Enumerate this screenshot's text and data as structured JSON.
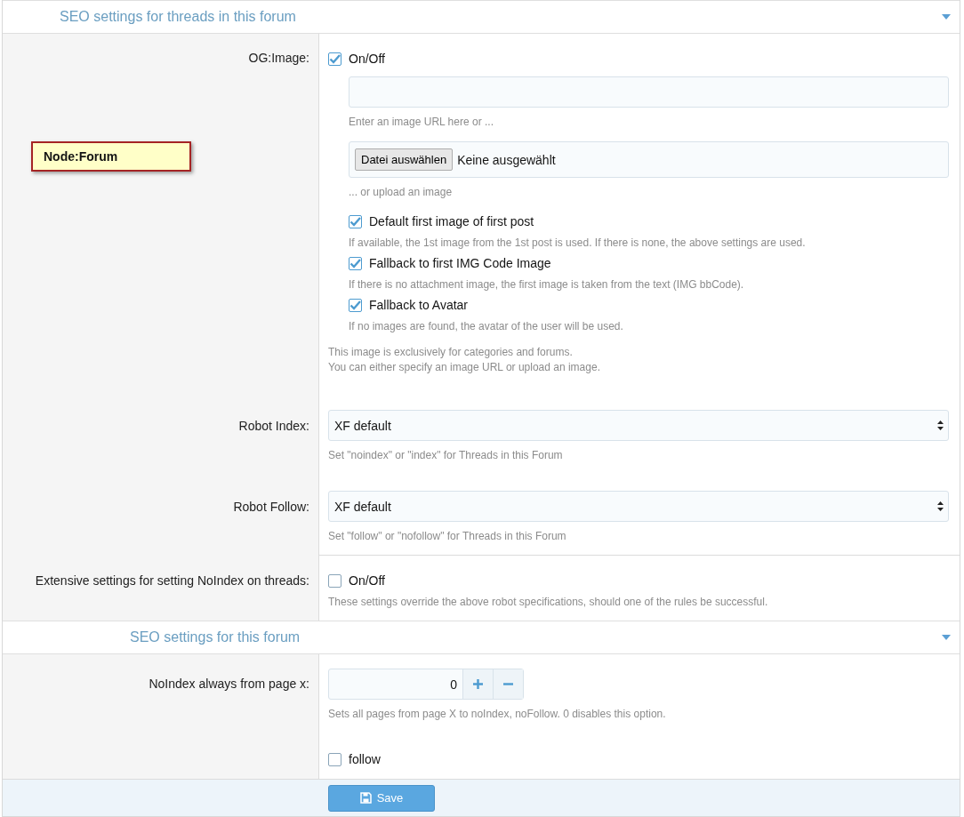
{
  "note": "Node:Forum",
  "sections": [
    {
      "title": "SEO settings for threads in this forum",
      "rows": [
        {
          "kind": "og_image",
          "label": "OG:Image:",
          "toggle": {
            "label": "On/Off",
            "checked": true
          },
          "url_hint": "Enter an image URL here or ...",
          "file_button": "Datei auswählen",
          "file_status": "Keine ausgewählt",
          "upload_hint": "... or upload an image",
          "options": [
            {
              "label": "Default first image of first post",
              "checked": true,
              "hint": "If available, the 1st image from the 1st post is used. If there is none, the above settings are used."
            },
            {
              "label": "Fallback to first IMG Code Image",
              "checked": true,
              "hint": "If there is no attachment image, the first image is taken from the text (IMG bbCode)."
            },
            {
              "label": "Fallback to Avatar",
              "checked": true,
              "hint": "If no images are found, the avatar of the user will be used."
            }
          ],
          "explain": [
            "This image is exclusively for categories and forums.",
            "You can either specify an image URL or upload an image."
          ]
        },
        {
          "kind": "select",
          "label": "Robot Index:",
          "value": "XF default",
          "hint": "Set \"noindex\" or \"index\" for Threads in this Forum"
        },
        {
          "kind": "select",
          "label": "Robot Follow:",
          "value": "XF default",
          "hint": "Set \"follow\" or \"nofollow\" for Threads in this Forum"
        },
        {
          "kind": "checkbox",
          "label": "Extensive settings for setting NoIndex on threads:",
          "option": {
            "label": "On/Off",
            "checked": false
          },
          "hint": "These settings override the above robot specifications, should one of the rules be successful."
        }
      ]
    },
    {
      "title": "SEO settings for this forum",
      "rows": [
        {
          "kind": "number",
          "label": "NoIndex always from page x:",
          "value": "0",
          "hint": "Sets all pages from page X to noIndex, noFollow. 0 disables this option.",
          "option": {
            "label": "follow",
            "checked": false
          }
        }
      ]
    }
  ],
  "save_button": "Save"
}
